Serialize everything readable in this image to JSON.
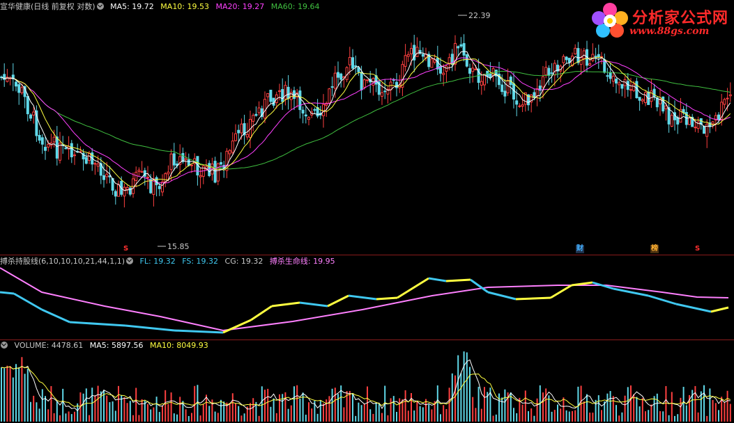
{
  "main_header": {
    "stock": "宣华健康(日线 前复权 对数)",
    "ma5": "MA5: 19.72",
    "ma10": "MA10: 19.53",
    "ma20": "MA20: 19.27",
    "ma60": "MA60: 19.64"
  },
  "indicator_header": {
    "name": "搏杀持股线(6,10,10,10,21,44,1,1)",
    "fl": "FL: 19.32",
    "fs": "FS: 19.32",
    "cg": "CG: 19.32",
    "life": "搏杀生命线: 19.95"
  },
  "volume_header": {
    "volume": "VOLUME: 4478.61",
    "ma5": "MA5: 5897.56",
    "ma10": "MA10: 8049.93"
  },
  "price_labels": {
    "high": "22.39",
    "low": "15.85"
  },
  "markers": {
    "s": "S",
    "cai": "财",
    "bang": "榜"
  },
  "logo": {
    "title": "分析家公式网",
    "url": "www.88gs.com"
  },
  "colors": {
    "up": "#ff4040",
    "down": "#60d8e8",
    "ma5": "#ffffff",
    "ma10": "#ffff40",
    "ma20": "#ff40ff",
    "ma60": "#40c040",
    "life": "#ff80ff",
    "fs_up": "#ffff40",
    "fs_down": "#40c8f0"
  }
}
